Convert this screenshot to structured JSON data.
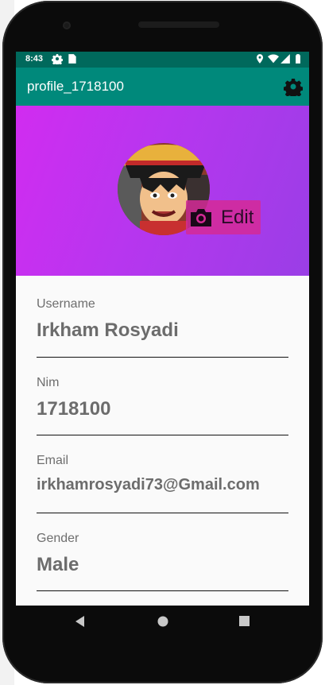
{
  "status_bar": {
    "time": "8:43"
  },
  "app_bar": {
    "title": "profile_1718100"
  },
  "header": {
    "edit_label": "Edit"
  },
  "fields": [
    {
      "label": "Username",
      "value": "Irkham Rosyadi"
    },
    {
      "label": "Nim",
      "value": "1718100"
    },
    {
      "label": "Email",
      "value": "irkhamrosyadi73@Gmail.com"
    },
    {
      "label": "Gender",
      "value": "Male"
    }
  ],
  "colors": {
    "status_bar": "#00695c",
    "app_bar": "#00897b",
    "header_start": "#d12cf0",
    "header_end": "#9a3ee6",
    "edit_button": "#d52a96"
  },
  "icons": {
    "status": [
      "settings-icon",
      "sim-card-icon",
      "location-icon",
      "wifi-icon",
      "signal-icon",
      "battery-icon"
    ],
    "app_bar": "settings-icon",
    "edit": "camera-icon",
    "nav": [
      "back-icon",
      "home-icon",
      "recents-icon"
    ]
  }
}
